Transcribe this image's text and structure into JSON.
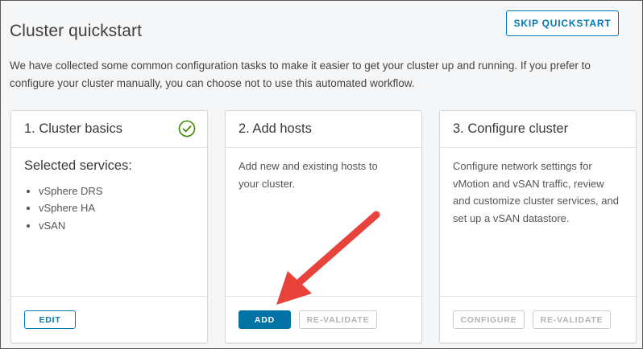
{
  "header": {
    "title": "Cluster quickstart",
    "skip_label": "SKIP QUICKSTART",
    "intro": "We have collected some common configuration tasks to make it easier to get your cluster up and running. If you prefer to configure your cluster manually, you can choose not to use this automated workflow."
  },
  "cards": [
    {
      "title": "1. Cluster basics",
      "status_icon": "check-circle-icon",
      "services_title": "Selected services:",
      "services": [
        "vSphere DRS",
        "vSphere HA",
        "vSAN"
      ],
      "edit_label": "EDIT"
    },
    {
      "title": "2. Add hosts",
      "description": "Add new and existing hosts to your cluster.",
      "add_label": "ADD",
      "revalidate_label": "RE-VALIDATE"
    },
    {
      "title": "3. Configure cluster",
      "description": "Configure network settings for vMotion and vSAN traffic, review and customize cluster services, and set up a vSAN datastore.",
      "configure_label": "CONFIGURE",
      "revalidate_label": "RE-VALIDATE"
    }
  ],
  "colors": {
    "accent": "#0079b8",
    "primary_button": "#0072a3",
    "success": "#3c8500",
    "annotation_arrow": "#e8423b"
  }
}
